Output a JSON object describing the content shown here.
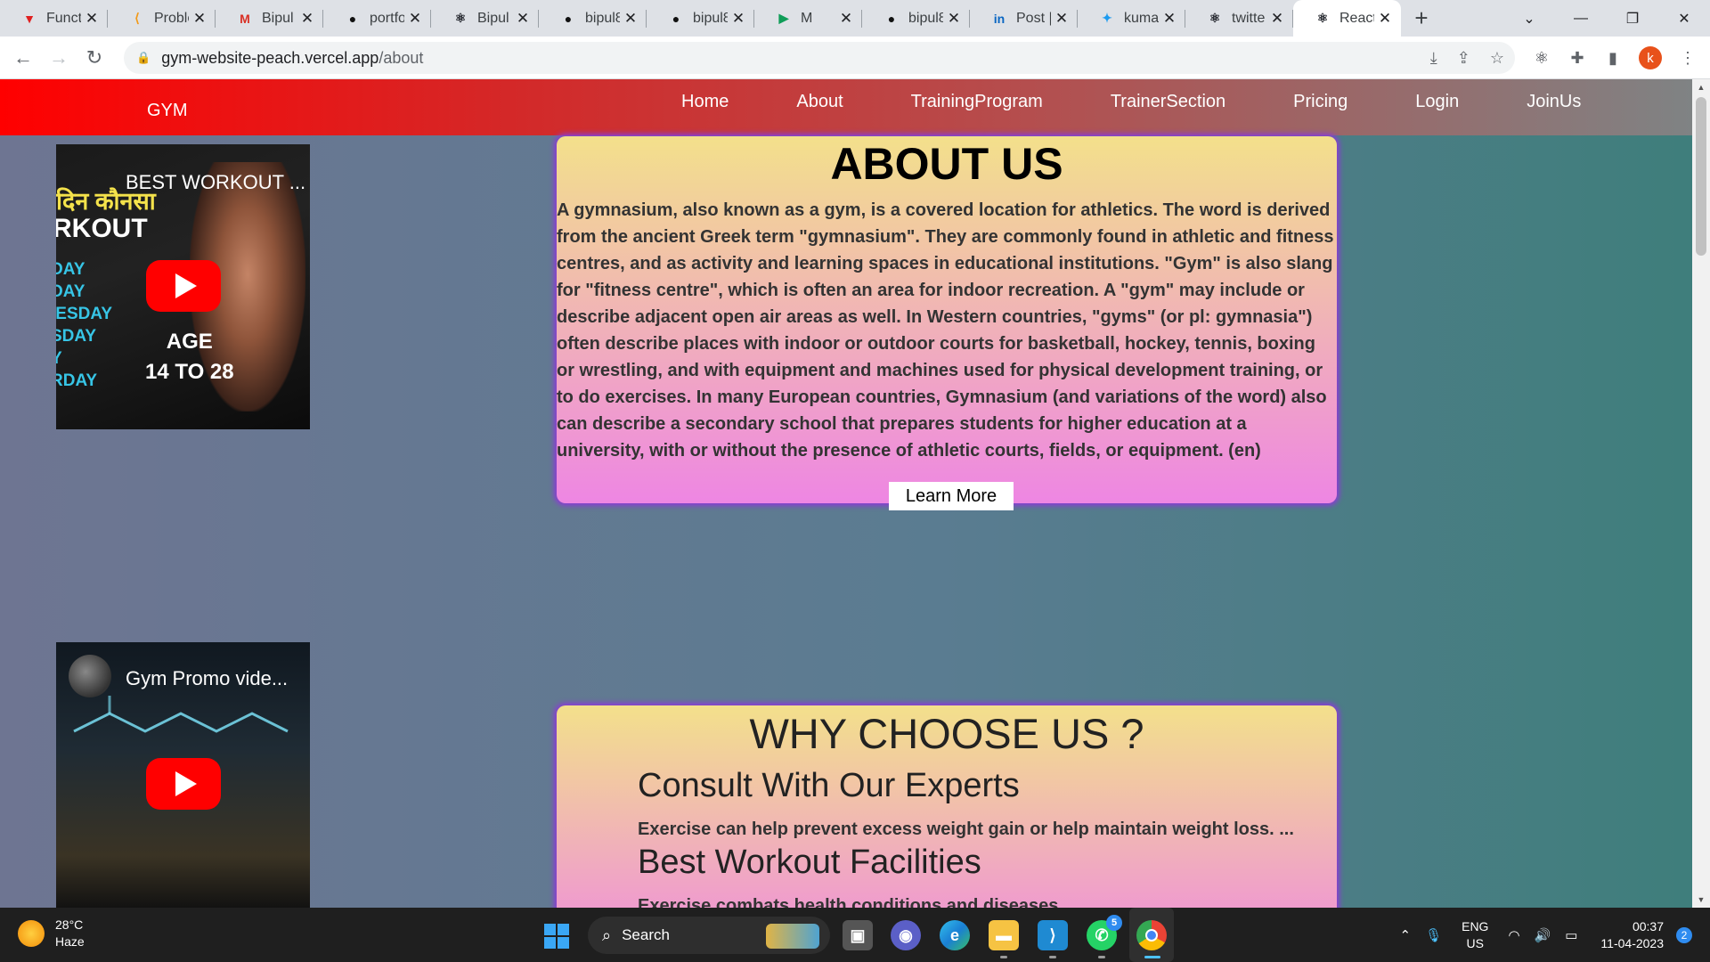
{
  "browser": {
    "tabs": [
      {
        "title": "Functi",
        "icon": "vercel-icon",
        "color": "#e02020"
      },
      {
        "title": "Proble",
        "icon": "leetcode-icon",
        "color": "#f29a1a"
      },
      {
        "title": "Bipul",
        "icon": "gmail-icon",
        "color": "#d93025"
      },
      {
        "title": "portfo",
        "icon": "github-icon",
        "color": "#111111"
      },
      {
        "title": "Bipul",
        "icon": "react-icon",
        "color": "#20232a"
      },
      {
        "title": "bipul8",
        "icon": "github-icon",
        "color": "#111111"
      },
      {
        "title": "bipul8",
        "icon": "github-icon",
        "color": "#111111"
      },
      {
        "title": "M",
        "icon": "meet-icon",
        "color": "#0f9d58"
      },
      {
        "title": "bipul8",
        "icon": "github-icon",
        "color": "#111111"
      },
      {
        "title": "Post |",
        "icon": "linkedin-icon",
        "color": "#0a66c2"
      },
      {
        "title": "kumar",
        "icon": "twitter-icon",
        "color": "#1d9bf0"
      },
      {
        "title": "twitte",
        "icon": "react-icon",
        "color": "#20232a"
      },
      {
        "title": "React",
        "icon": "react-icon",
        "color": "#20232a"
      }
    ],
    "active_tab": 12,
    "url_host": "gym-website-peach.vercel.app",
    "url_path": "/about",
    "profile_initial": "k"
  },
  "site": {
    "logo": "GYM",
    "nav": [
      "Home",
      "About",
      "TrainingProgram",
      "TrainerSection",
      "Pricing",
      "Login",
      "JoinUs"
    ],
    "videos": [
      {
        "title": "BEST WORKOUT ...",
        "thumb_lines": [
          "दिन कौनसा",
          "RKOUT"
        ],
        "days": [
          "DAY",
          "DAY",
          "IESDAY",
          "SDAY",
          "Y",
          "RDAY"
        ],
        "age_label": "AGE",
        "age_range": "14 TO 28"
      },
      {
        "title": "Gym Promo vide..."
      }
    ],
    "about": {
      "heading": "ABOUT US",
      "body": "A gymnasium, also known as a gym, is a covered location for athletics. The word is derived from the ancient Greek term \"gymnasium\". They are commonly found in athletic and fitness centres, and as activity and learning spaces in educational institutions. \"Gym\" is also slang for \"fitness centre\", which is often an area for indoor recreation. A \"gym\" may include or describe adjacent open air areas as well. In Western countries, \"gyms\" (or pl: gymnasia\") often describe places with indoor or outdoor courts for basketball, hockey, tennis, boxing or wrestling, and with equipment and machines used for physical development training, or to do exercises. In many European countries, Gymnasium (and variations of the word) also can describe a secondary school that prepares students for higher education at a university, with or without the presence of athletic courts, fields, or equipment. (en)",
      "button": "Learn More"
    },
    "why": {
      "heading": "WHY CHOOSE US ?",
      "items": [
        {
          "title": "Consult With Our Experts",
          "text": "Exercise can help prevent excess weight gain or help maintain weight loss. ..."
        },
        {
          "title": "Best Workout Facilities",
          "text": "Exercise combats health conditions and diseases."
        }
      ]
    }
  },
  "taskbar": {
    "weather_temp": "28°C",
    "weather_desc": "Haze",
    "search_label": "Search",
    "whatsapp_badge": "5",
    "lang_top": "ENG",
    "lang_bottom": "US",
    "time": "00:37",
    "date": "11-04-2023",
    "notifications": "2"
  }
}
